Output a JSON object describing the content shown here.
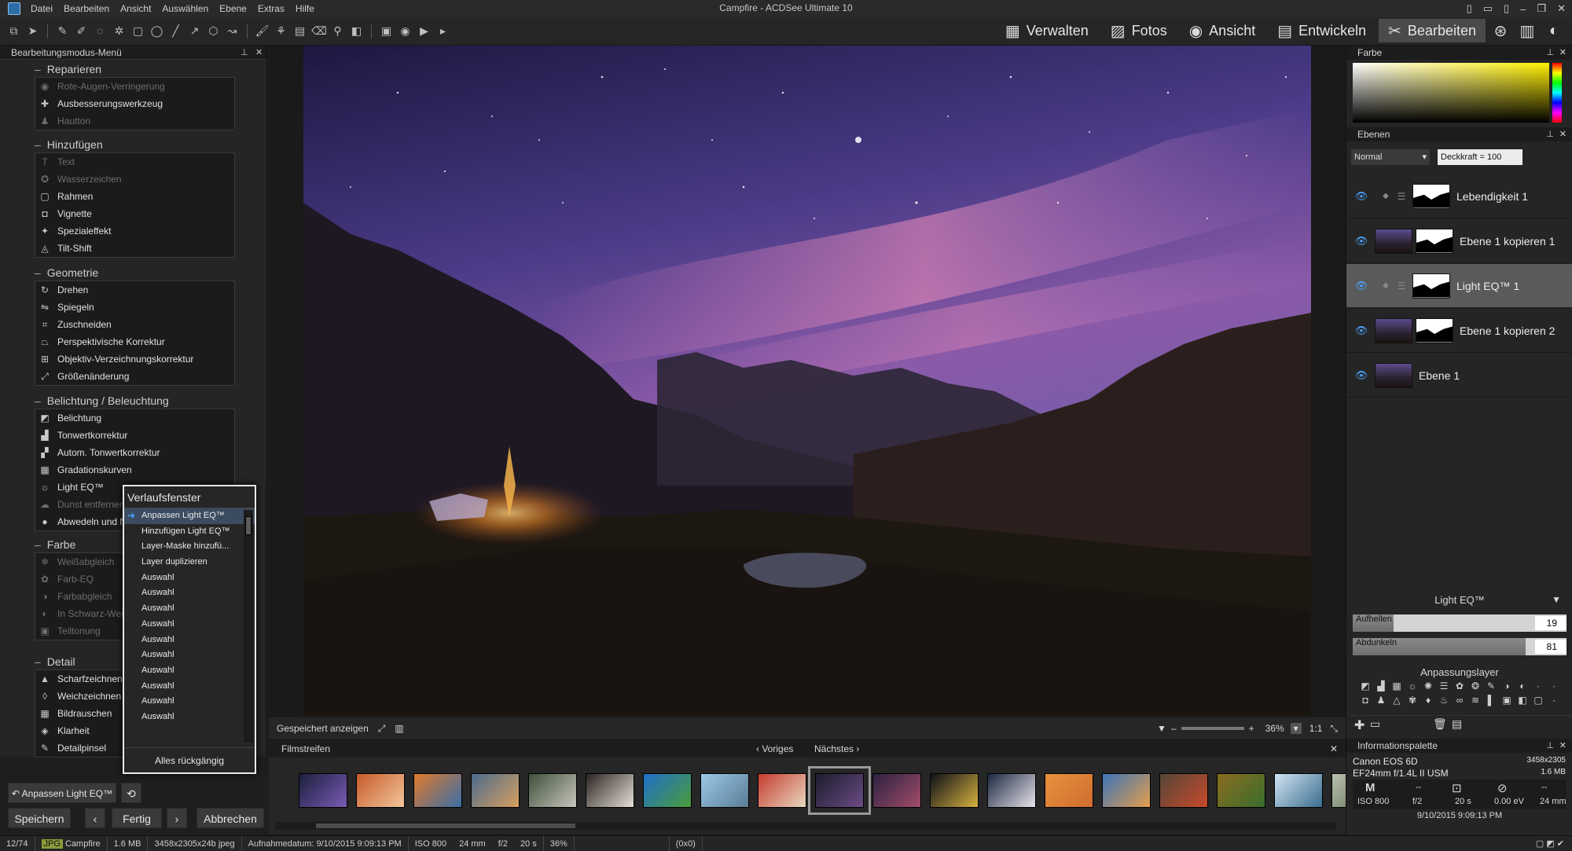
{
  "window": {
    "title": "Campfire - ACDSee Ultimate 10",
    "menus": [
      "Datei",
      "Bearbeiten",
      "Ansicht",
      "Auswählen",
      "Ebene",
      "Extras",
      "Hilfe"
    ]
  },
  "modes": [
    {
      "label": "Verwalten",
      "icon": "grid-icon"
    },
    {
      "label": "Fotos",
      "icon": "photos-icon"
    },
    {
      "label": "Ansicht",
      "icon": "eye-icon"
    },
    {
      "label": "Entwickeln",
      "icon": "develop-icon"
    },
    {
      "label": "Bearbeiten",
      "icon": "edit-icon",
      "active": true
    }
  ],
  "left_panel": {
    "title": "Bearbeitungsmodus-Menü",
    "sections": [
      {
        "title": "Reparieren",
        "items": [
          {
            "label": "Rote-Augen-Verringerung",
            "icon": "eye-icon",
            "dim": true
          },
          {
            "label": "Ausbesserungswerkzeug",
            "icon": "patch-icon"
          },
          {
            "label": "Hautton",
            "icon": "person-icon",
            "dim": true
          }
        ]
      },
      {
        "title": "Hinzufügen",
        "items": [
          {
            "label": "Text",
            "icon": "text-icon",
            "dim": true
          },
          {
            "label": "Wasserzeichen",
            "icon": "watermark-icon",
            "dim": true
          },
          {
            "label": "Rahmen",
            "icon": "frame-icon"
          },
          {
            "label": "Vignette",
            "icon": "vignette-icon"
          },
          {
            "label": "Spezialeffekt",
            "icon": "effect-icon"
          },
          {
            "label": "Tilt-Shift",
            "icon": "tiltshift-icon"
          }
        ]
      },
      {
        "title": "Geometrie",
        "items": [
          {
            "label": "Drehen",
            "icon": "rotate-icon"
          },
          {
            "label": "Spiegeln",
            "icon": "flip-icon"
          },
          {
            "label": "Zuschneiden",
            "icon": "crop-icon"
          },
          {
            "label": "Perspektivische Korrektur",
            "icon": "perspective-icon"
          },
          {
            "label": "Objektiv-Verzeichnungskorrektur",
            "icon": "lens-icon"
          },
          {
            "label": "Größenänderung",
            "icon": "resize-icon"
          }
        ]
      },
      {
        "title": "Belichtung / Beleuchtung",
        "items": [
          {
            "label": "Belichtung",
            "icon": "exposure-icon"
          },
          {
            "label": "Tonwertkorrektur",
            "icon": "levels-icon"
          },
          {
            "label": "Autom. Tonwertkorrektur",
            "icon": "autolevels-icon"
          },
          {
            "label": "Gradationskurven",
            "icon": "curves-icon"
          },
          {
            "label": "Light EQ™",
            "icon": "sun-icon"
          },
          {
            "label": "Dunst entfernen",
            "icon": "haze-icon",
            "dim": true
          },
          {
            "label": "Abwedeln und Nachbelichten",
            "icon": "dodge-icon"
          }
        ]
      },
      {
        "title": "Farbe",
        "items": [
          {
            "label": "Weißabgleich",
            "icon": "whitebalance-icon",
            "dim": true
          },
          {
            "label": "Farb-EQ",
            "icon": "color-eq-icon",
            "dim": true
          },
          {
            "label": "Farbabgleich",
            "icon": "color-balance-icon",
            "dim": true
          },
          {
            "label": "In Schwarz-Weiß umwandeln",
            "icon": "bw-icon",
            "dim": true
          },
          {
            "label": "Teiltonung",
            "icon": "split-tone-icon",
            "dim": true
          }
        ]
      },
      {
        "title": "Detail",
        "items": [
          {
            "label": "Scharfzeichnen",
            "icon": "sharpen-icon"
          },
          {
            "label": "Weichzeichnen",
            "icon": "blur-icon"
          },
          {
            "label": "Bildrauschen",
            "icon": "noise-icon"
          },
          {
            "label": "Klarheit",
            "icon": "clarity-icon"
          },
          {
            "label": "Detailpinsel",
            "icon": "detail-brush-icon"
          }
        ]
      }
    ],
    "undo_label": "Anpassen Light EQ™",
    "save": "Speichern",
    "done": "Fertig",
    "cancel": "Abbrechen"
  },
  "history": {
    "title": "Verlaufsfenster",
    "items": [
      "Anpassen Light EQ™",
      "Hinzufügen Light EQ™",
      "Layer-Maske hinzufü...",
      "Layer duplizieren",
      "Auswahl",
      "Auswahl",
      "Auswahl",
      "Auswahl",
      "Auswahl",
      "Auswahl",
      "Auswahl",
      "Auswahl",
      "Auswahl",
      "Auswahl"
    ],
    "undo_all": "Alles rückgängig"
  },
  "viewbar": {
    "show_saved": "Gespeichert anzeigen",
    "zoom": "36%",
    "ratio": "1:1"
  },
  "filmstrip": {
    "title": "Filmstreifen",
    "prev": "Voriges",
    "next": "Nächstes",
    "thumbs": [
      {
        "c1": "#1a1f3b",
        "c2": "#7b5bb7"
      },
      {
        "c1": "#c75a2a",
        "c2": "#f2c79b"
      },
      {
        "c1": "#e07a2b",
        "c2": "#3a6ea8"
      },
      {
        "c1": "#4a6b8c",
        "c2": "#d8a060"
      },
      {
        "c1": "#3e4f3a",
        "c2": "#c9c7bd"
      },
      {
        "c1": "#2b2421",
        "c2": "#e6e0d8"
      },
      {
        "c1": "#1f6fc9",
        "c2": "#4a9c3a"
      },
      {
        "c1": "#9bc9e6",
        "c2": "#5a7c97"
      },
      {
        "c1": "#c43b2d",
        "c2": "#e8d8c0"
      },
      {
        "c1": "#1c1c2c",
        "c2": "#6b4c86"
      },
      {
        "c1": "#2a2240",
        "c2": "#a24c6a"
      },
      {
        "c1": "#0c1018",
        "c2": "#d8b140"
      },
      {
        "c1": "#1b2840",
        "c2": "#e8e4ec"
      },
      {
        "c1": "#e6913d",
        "c2": "#d06d2f"
      },
      {
        "c1": "#3d73b9",
        "c2": "#e39f4a"
      },
      {
        "c1": "#544639",
        "c2": "#c84a2a"
      },
      {
        "c1": "#8a6b1f",
        "c2": "#3a6d2e"
      },
      {
        "c1": "#d2e4f2",
        "c2": "#3a6d8f"
      },
      {
        "c1": "#b9c1b0",
        "c2": "#5c6a50"
      }
    ]
  },
  "right": {
    "color_title": "Farbe",
    "layers_title": "Ebenen",
    "blend_mode": "Normal",
    "opacity": "Deckkraft = 100",
    "layers": [
      {
        "name": "Lebendigkeit 1",
        "kind": "adjust"
      },
      {
        "name": "Ebene 1 kopieren 1",
        "kind": "image"
      },
      {
        "name": "Light EQ™ 1",
        "kind": "adjust",
        "selected": true
      },
      {
        "name": "Ebene 1 kopieren 2",
        "kind": "image"
      },
      {
        "name": "Ebene 1",
        "kind": "image-nomask"
      }
    ],
    "adj_title": "Light EQ™",
    "sliders": [
      {
        "label": "Aufhellen",
        "value": 19,
        "max": 100
      },
      {
        "label": "Abdunkeln",
        "value": 81,
        "max": 100
      }
    ],
    "adj_layer_title": "Anpassungslayer",
    "info_title": "Informationspalette",
    "camera": "Canon EOS 6D",
    "lens": "EF24mm f/1.4L II USM",
    "resolution": "3458x2305",
    "filesize": "1.6 MB",
    "mode": "M",
    "iso": "ISO 800",
    "fnum": "f/2",
    "shutter": "20 s",
    "ev": "0.00 eV",
    "focal": "24 mm",
    "date": "9/10/2015 9:09:13 PM",
    "dashes": "--"
  },
  "status": {
    "count": "12/74",
    "type": "JPG",
    "name": "Campfire",
    "size": "1.6 MB",
    "dims": "3458x2305x24b jpeg",
    "date": "Aufnahmedatum: 9/10/2015 9:09:13 PM",
    "iso": "ISO 800",
    "focal": "24 mm",
    "fnum": "f/2",
    "shutter": "20 s",
    "zoom": "36%",
    "coords": "(0x0)"
  }
}
